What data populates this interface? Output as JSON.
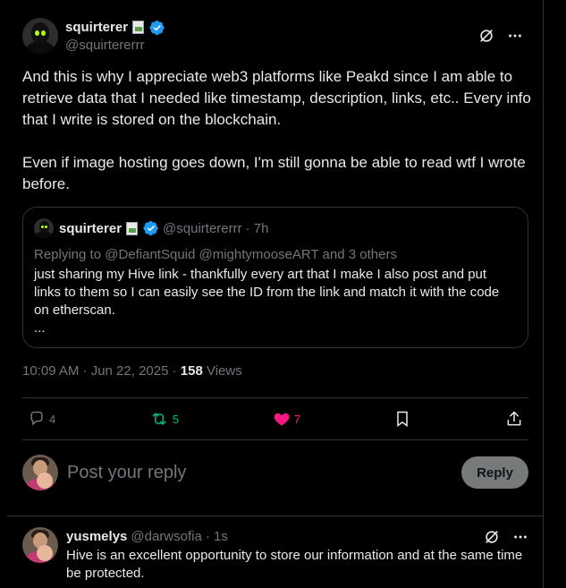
{
  "main_tweet": {
    "author_name": "squirterer",
    "author_handle": "@squirtererrr",
    "text": "And this is why I appreciate web3 platforms like Peakd since I am able to retrieve data that I needed like timestamp, description, links, etc.. Every info that I write is stored on the blockchain.\n\nEven if image hosting goes down, I'm still gonna be able to read wtf I wrote before.",
    "timestamp": "10:09 AM · Jun 22, 2025 · ",
    "views_count": "158",
    "views_label": " Views"
  },
  "quote": {
    "author_name": "squirterer",
    "author_handle": "@squirtererrr",
    "time": "· 7h",
    "replying_to": "Replying to @DefiantSquid @mightymooseART and 3 others",
    "text": "just sharing my Hive link - thankfully every art that I make I also post and put links to them so I can easily see the ID from the link and match it with the code on etherscan.\n..."
  },
  "actions": {
    "replies": "4",
    "reposts": "5",
    "likes": "7",
    "retweet_color": "#00ba7c",
    "like_color": "#f91880"
  },
  "composer": {
    "placeholder": "Post your reply",
    "reply_button": "Reply"
  },
  "reply_tweet": {
    "author_name": "yusmelys",
    "author_handle": "@darwsofia",
    "time": "· 1s",
    "text": "Hive is an excellent opportunity to store our information and at the same time be protected."
  },
  "icons": {
    "verified": "verified-badge-icon",
    "grok": "grok-icon",
    "more": "more-icon",
    "reply": "reply-icon",
    "repost": "repost-icon",
    "like": "heart-icon",
    "bookmark": "bookmark-icon",
    "share": "share-icon"
  },
  "colors": {
    "background": "#000000",
    "text": "#e7e9ea",
    "muted": "#71767b",
    "verified": "#1d9bf0",
    "border": "#2f3336"
  }
}
